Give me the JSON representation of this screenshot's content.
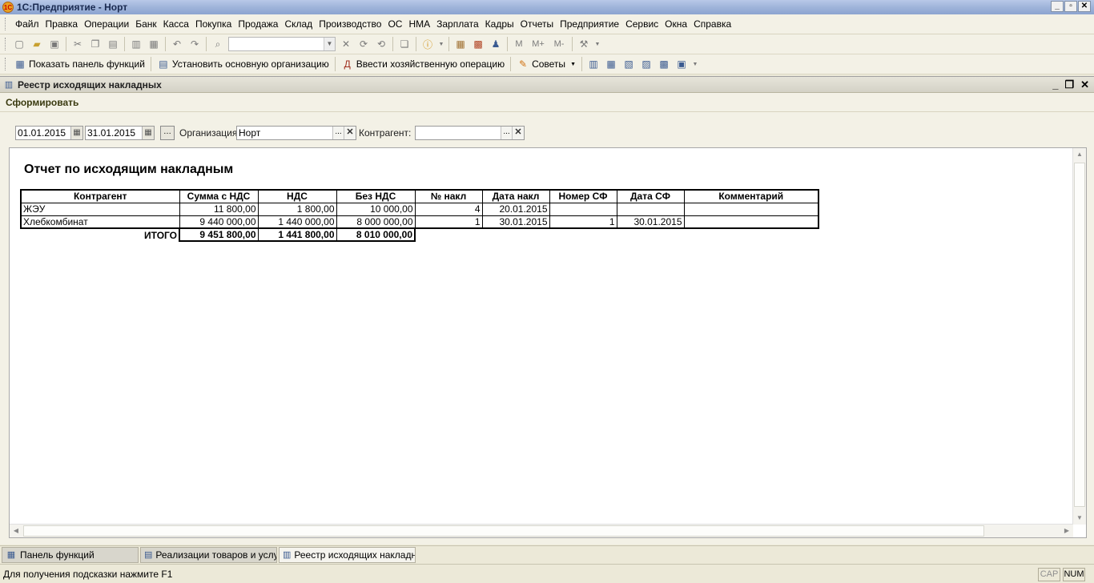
{
  "window": {
    "title": "1С:Предприятие - Норт",
    "icon": "1c-logo-icon",
    "logo_text": "1С"
  },
  "menu": [
    "Файл",
    "Правка",
    "Операции",
    "Банк",
    "Касса",
    "Покупка",
    "Продажа",
    "Склад",
    "Производство",
    "ОС",
    "НМА",
    "Зарплата",
    "Кадры",
    "Отчеты",
    "Предприятие",
    "Сервис",
    "Окна",
    "Справка"
  ],
  "toolbar2": {
    "show_panel": "Показать панель функций",
    "set_org": "Установить основную организацию",
    "enter_op": "Ввести хозяйственную операцию",
    "tips": "Советы"
  },
  "doc": {
    "title": "Реестр исходящих накладных",
    "generate": "Сформировать",
    "date_from": "01.01.2015",
    "date_to": "31.01.2015",
    "org_label": "Организация:",
    "org_value": "Норт",
    "contractor_label": "Контрагент:",
    "contractor_value": ""
  },
  "report": {
    "title": "Отчет по исходящим накладным",
    "columns": [
      "Контрагент",
      "Сумма с НДС",
      "НДС",
      "Без НДС",
      "№ накл",
      "Дата накл",
      "Номер СФ",
      "Дата СФ",
      "Комментарий"
    ],
    "rows": [
      [
        "ЖЭУ",
        "11 800,00",
        "1 800,00",
        "10 000,00",
        "4",
        "20.01.2015",
        "",
        "",
        ""
      ],
      [
        "Хлебкомбинат",
        "9 440 000,00",
        "1 440 000,00",
        "8 000 000,00",
        "1",
        "30.01.2015",
        "1",
        "30.01.2015",
        ""
      ]
    ],
    "total": {
      "label": "ИТОГО",
      "sum": "9 451 800,00",
      "vat": "1 441 800,00",
      "net": "8 010 000,00"
    }
  },
  "tabs": [
    {
      "label": "Панель функций",
      "icon": "function-panel-icon"
    },
    {
      "label": "Реализации товаров и услуг",
      "icon": "document-list-icon"
    },
    {
      "label": "Реестр исходящих накладн...",
      "icon": "report-icon"
    }
  ],
  "status": {
    "hint": "Для получения подсказки нажмите F1",
    "cap": "CAP",
    "num": "NUM"
  }
}
